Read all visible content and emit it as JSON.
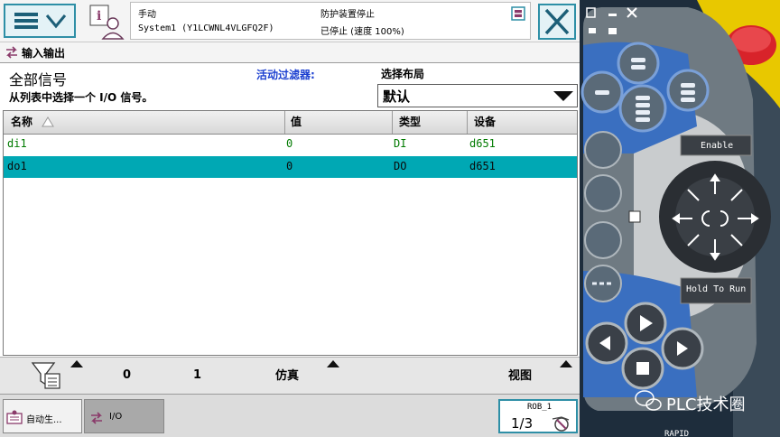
{
  "header": {
    "mode": "手动",
    "system": "System1 (Y1LCWNL4VLGFQ2F)",
    "state": "防护装置停止",
    "speed": "已停止 (速度 100%)"
  },
  "breadcrumb": {
    "title": "输入输出"
  },
  "filter": {
    "list_title": "全部信号",
    "instruction": "从列表中选择一个 I/O 信号。",
    "active_filter_label": "活动过滤器:",
    "layout_label": "选择布局",
    "layout_value": "默认"
  },
  "table": {
    "columns": [
      "名称",
      "值",
      "类型",
      "设备"
    ],
    "rows": [
      {
        "name": "di1",
        "value": "0",
        "type": "DI",
        "device": "d651",
        "selected": false
      },
      {
        "name": "do1",
        "value": "0",
        "type": "DO",
        "device": "d651",
        "selected": true
      }
    ]
  },
  "bottombar": {
    "zero": "0",
    "one": "1",
    "simulate": "仿真",
    "view": "视图"
  },
  "taskbar": {
    "task1": "自动生...",
    "task2": "I/O",
    "rob_label": "ROB_1",
    "fraction": "1/3"
  },
  "pendant": {
    "enable": "Enable",
    "hold_to_run": "Hold To Run",
    "watermark": "PLC技术圈",
    "rapid": "RAPID"
  },
  "colors": {
    "accent": "#2e8fa6",
    "selected_row": "#00a8b4",
    "text_green": "#007a00",
    "pendant_blue": "#3a6fc0",
    "emergency_red": "#d8232a"
  }
}
